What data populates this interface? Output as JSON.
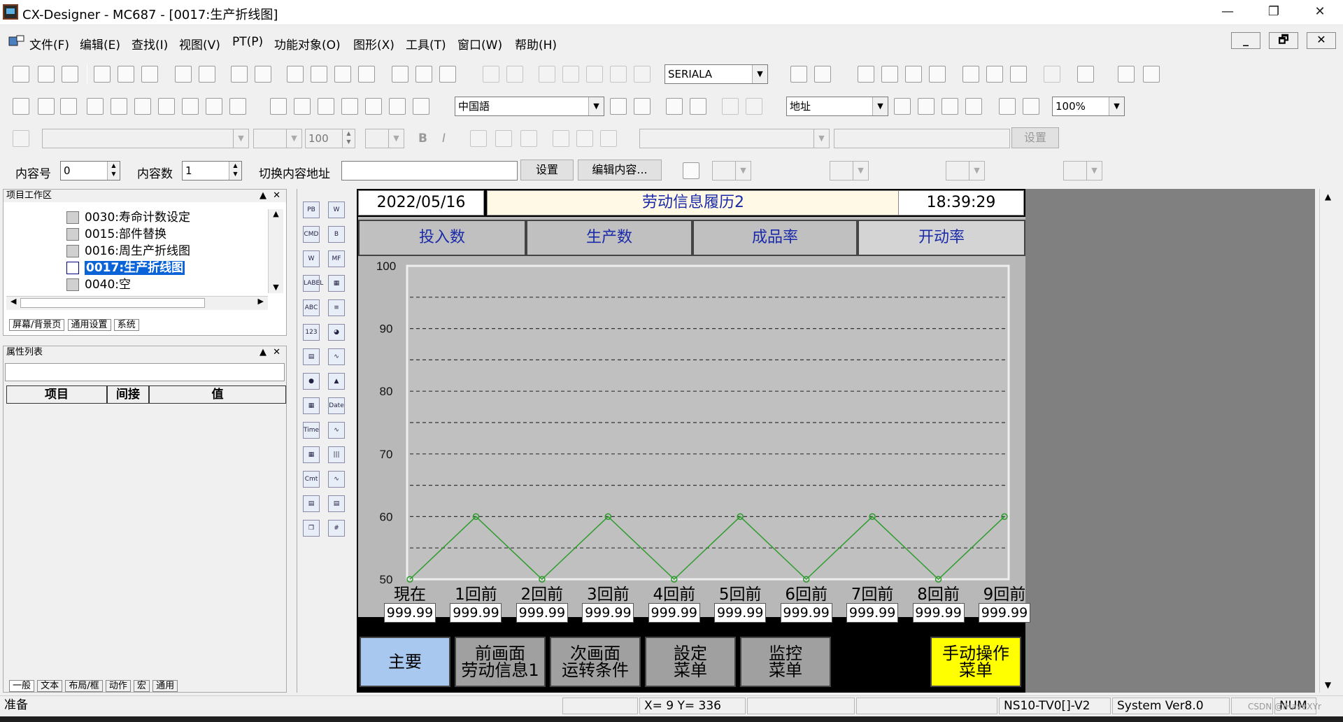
{
  "window": {
    "title": "CX-Designer - MC687 - [0017:生产折线图]",
    "controls": [
      "—",
      "❐",
      "✕"
    ],
    "mdi_controls": [
      "_",
      "🗗",
      "✕"
    ]
  },
  "menu": [
    "文件(F)",
    "编辑(E)",
    "查找(I)",
    "视图(V)",
    "PT(P)",
    "功能对象(O)",
    "图形(X)",
    "工具(T)",
    "窗口(W)",
    "帮助(H)"
  ],
  "toolbar": {
    "port_combo": "SERIALA",
    "language_combo": "中国語",
    "address_combo": "地址",
    "zoom_combo": "100%",
    "font_size": "100",
    "bold": "B",
    "italic": "I",
    "set_label": "设置",
    "content_no_label": "内容号",
    "content_no_value": "0",
    "content_count_label": "内容数",
    "content_count_value": "1",
    "switch_address_label": "切换内容地址",
    "set_button": "设置",
    "edit_content_button": "编辑内容..."
  },
  "project_panel": {
    "title": "项目工作区",
    "items": [
      {
        "label": "0030:寿命计数设定",
        "selected": false
      },
      {
        "label": "0015:部件替换",
        "selected": false
      },
      {
        "label": "0016:周生产折线图",
        "selected": false
      },
      {
        "label": "0017:生产折线图",
        "selected": true
      },
      {
        "label": "0040:空",
        "selected": false
      }
    ],
    "tabs": [
      "屏幕/背景页",
      "通用设置",
      "系统"
    ]
  },
  "property_panel": {
    "title": "属性列表",
    "columns": [
      "项目",
      "间接",
      "值"
    ],
    "tabs": [
      "一般",
      "文本",
      "布局/框",
      "动作",
      "宏",
      "通用"
    ]
  },
  "palette": [
    "PB",
    "W",
    "CMD",
    "B",
    "W",
    "MF",
    "LABEL",
    "▦",
    "ABC",
    "≡",
    "123",
    "◕",
    "▤",
    "∿",
    "●",
    "▲",
    "▦",
    "Date",
    "Time",
    "∿",
    "▦",
    "|||",
    "Cmt",
    "∿",
    "▤",
    "▤",
    "❐",
    "#"
  ],
  "screen": {
    "date": "2022/05/16",
    "header_title": "劳动信息履历2",
    "time": "18:39:29",
    "tabs": [
      "投入数",
      "生产数",
      "成品率",
      "开动率"
    ],
    "selected_tab": "开动率",
    "value_placeholder": "999.99",
    "nav_buttons": [
      {
        "label": "主要",
        "color": "#a8c8f0"
      },
      {
        "label": "前画面\n劳动信息1",
        "color": "#a0a0a0"
      },
      {
        "label": "次画面\n运转条件",
        "color": "#a0a0a0"
      },
      {
        "label": "設定\n菜单",
        "color": "#a0a0a0"
      },
      {
        "label": "监控\n菜单",
        "color": "#a0a0a0"
      },
      {
        "label": "手动操作\n菜单",
        "color": "#ffff00"
      }
    ]
  },
  "chart_data": {
    "type": "line",
    "categories": [
      "現在",
      "1回前",
      "2回前",
      "3回前",
      "4回前",
      "5回前",
      "6回前",
      "7回前",
      "8回前",
      "9回前"
    ],
    "y_ticks": [
      100,
      90,
      80,
      70,
      60,
      50
    ],
    "ylim": [
      50,
      100
    ],
    "grid": "dashed",
    "series": [
      {
        "color": "#2e9b2e",
        "values": [
          50,
          60,
          50,
          60,
          50,
          60,
          50,
          60,
          50,
          60
        ]
      }
    ]
  },
  "status": {
    "ready": "准备",
    "coords": "X=   9 Y= 336",
    "pt_model": "NS10-TV0[]-V2",
    "system_ver": "System Ver8.0",
    "num": "NUM",
    "watermark": "CSDN @IHaveXYr"
  }
}
